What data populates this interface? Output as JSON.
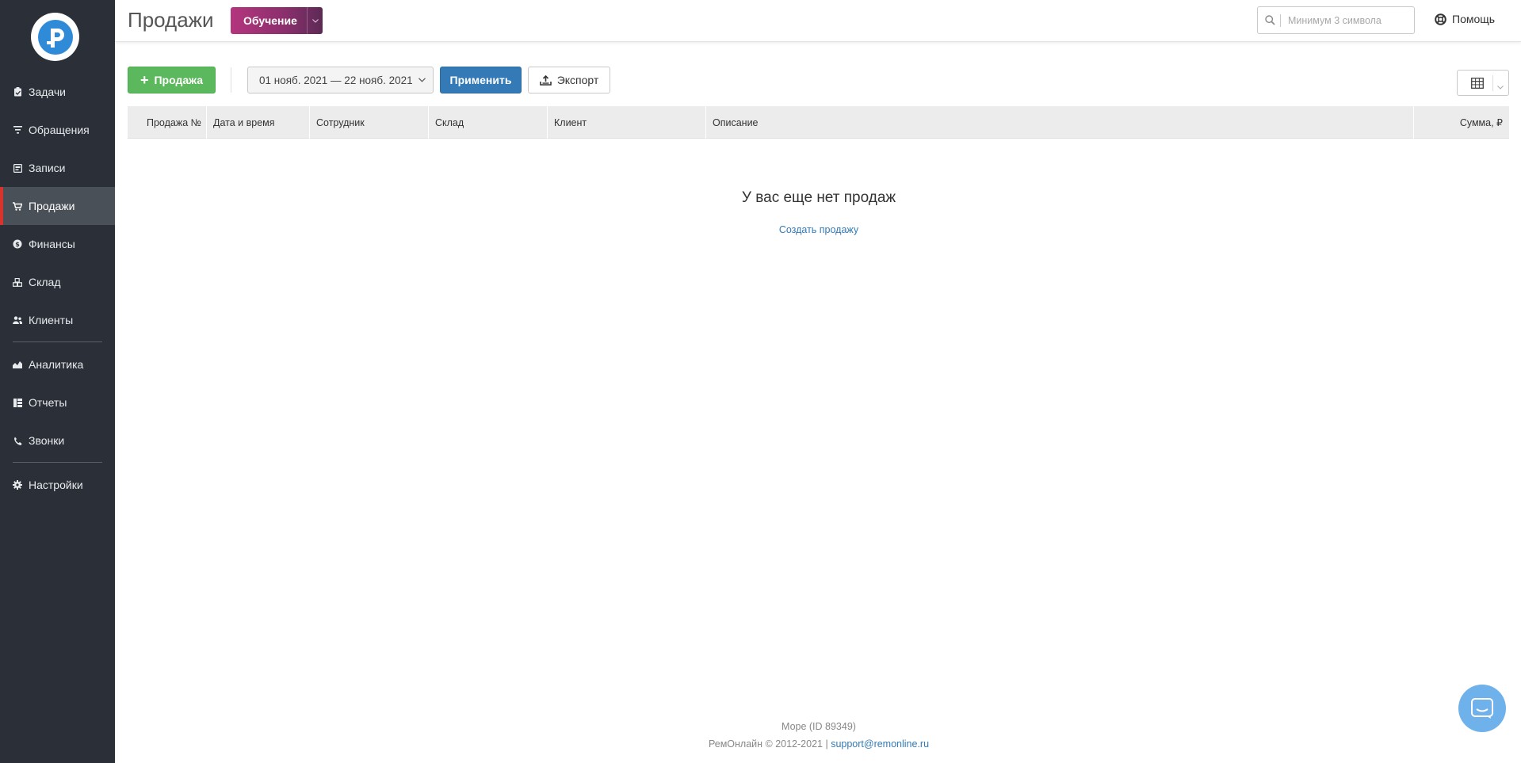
{
  "sidebar": {
    "items": [
      {
        "label": "Задачи",
        "icon": "clipboard-icon"
      },
      {
        "label": "Обращения",
        "icon": "filter-icon"
      },
      {
        "label": "Записи",
        "icon": "calendar-icon"
      },
      {
        "label": "Продажи",
        "icon": "cart-icon",
        "active": true
      },
      {
        "label": "Финансы",
        "icon": "coin-icon"
      },
      {
        "label": "Склад",
        "icon": "boxes-icon"
      },
      {
        "label": "Клиенты",
        "icon": "users-icon"
      },
      {
        "label": "Аналитика",
        "icon": "area-chart-icon"
      },
      {
        "label": "Отчеты",
        "icon": "report-icon"
      },
      {
        "label": "Звонки",
        "icon": "phone-icon"
      },
      {
        "label": "Настройки",
        "icon": "gear-icon"
      }
    ]
  },
  "header": {
    "title": "Продажи",
    "learn_label": "Обучение",
    "search_placeholder": "Минимум 3 символа",
    "help_label": "Помощь"
  },
  "toolbar": {
    "add_label": "Продажа",
    "date_range": "01 нояб. 2021 — 22 нояб. 2021",
    "apply_label": "Применить",
    "export_label": "Экспорт"
  },
  "table": {
    "columns": [
      "Продажа №",
      "Дата и время",
      "Сотрудник",
      "Склад",
      "Клиент",
      "Описание",
      "Сумма, ₽"
    ]
  },
  "empty_state": {
    "title": "У вас еще нет продаж",
    "link": "Создать продажу"
  },
  "footer": {
    "account": "Море (ID 89349)",
    "copyright": "РемОнлайн © 2012-2021 |",
    "support_email": "support@remonline.ru"
  },
  "colors": {
    "sidebar_bg": "#2b3038",
    "active_marker": "#d9342b",
    "add_button": "#5cb85c",
    "apply_button": "#337ab7",
    "learn_button": "#9b3276",
    "chat_widget": "#6fb1ea"
  }
}
